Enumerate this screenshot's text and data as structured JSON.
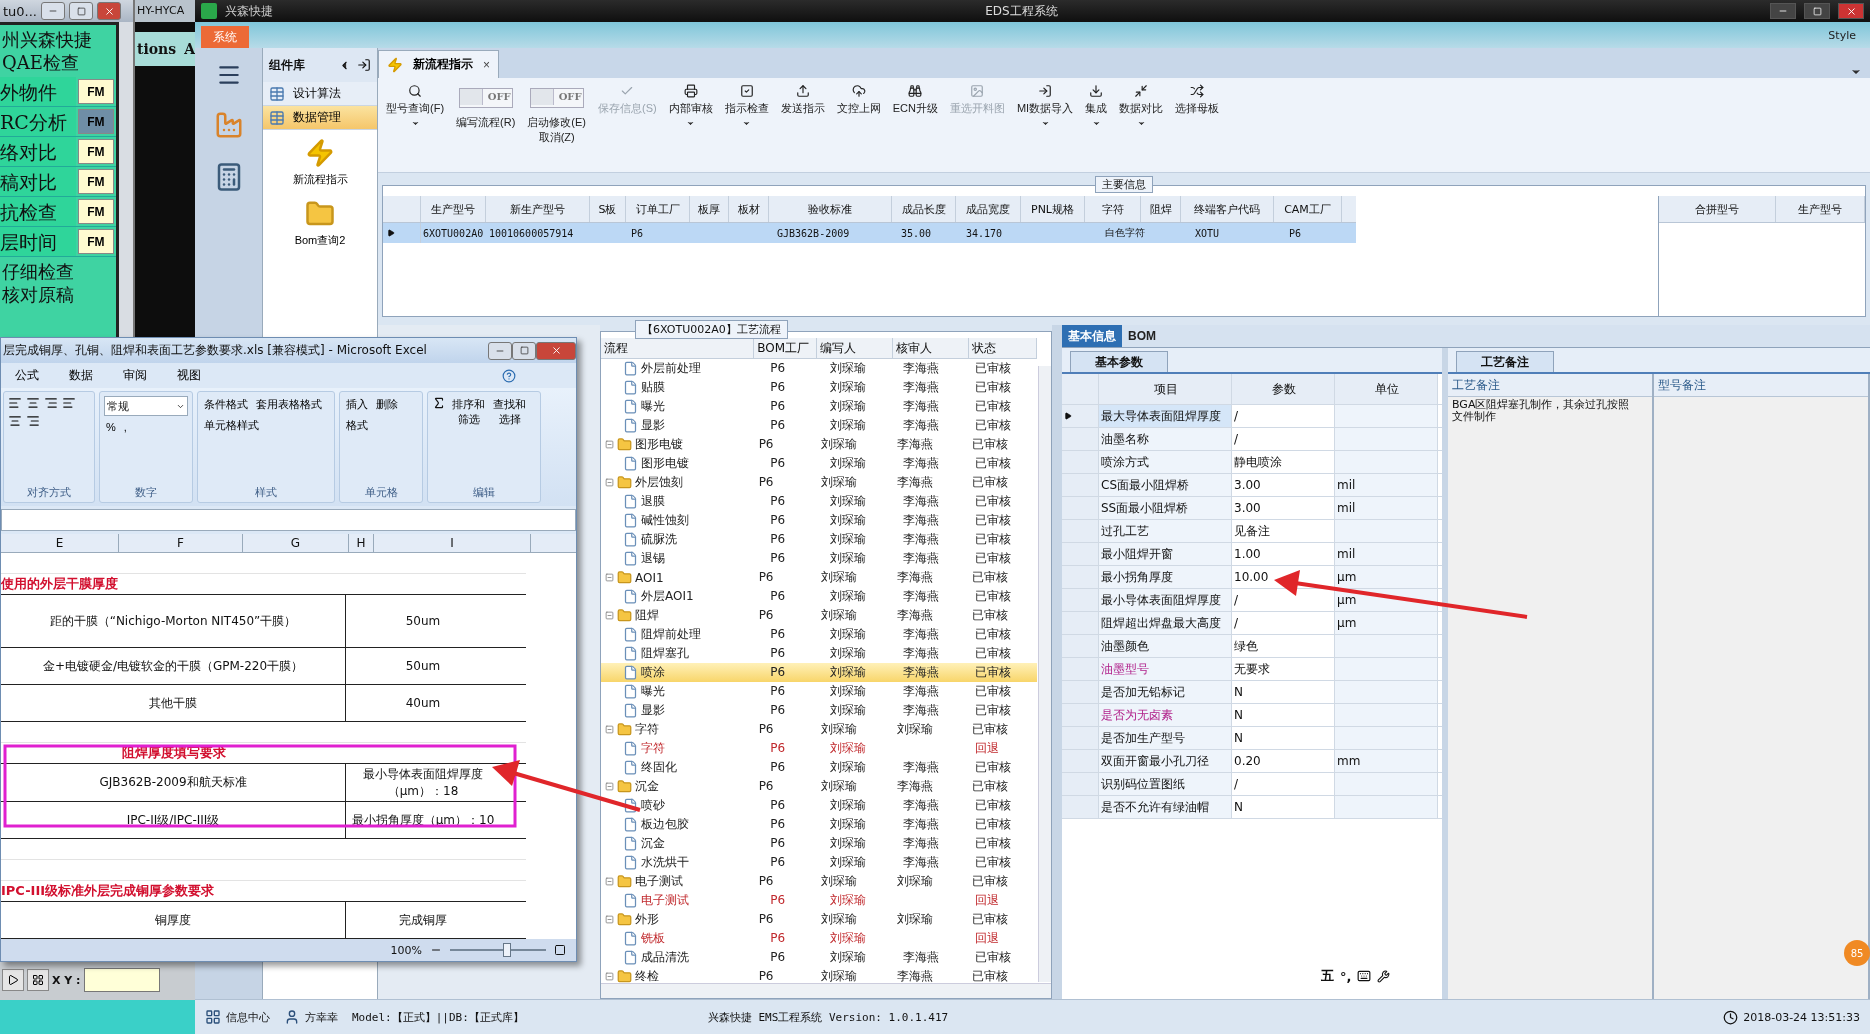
{
  "background_window": {
    "title": "tu0...",
    "items": [
      {
        "lines": [
          "州兴森快捷",
          "QAE检查"
        ]
      },
      {
        "label": "外物件",
        "button": "FM",
        "selected": false
      },
      {
        "label": "RC分析",
        "button": "FM",
        "selected": true
      },
      {
        "label": "络对比",
        "button": "FM",
        "selected": false
      },
      {
        "label": "稿对比",
        "button": "FM",
        "selected": false
      },
      {
        "label": "抗检查",
        "button": "FM",
        "selected": false
      },
      {
        "label": "层时间",
        "button": "FM",
        "selected": false
      },
      {
        "lines": [
          "仔细检查",
          "核对原稿"
        ]
      }
    ],
    "coordinate_label": "X Y :"
  },
  "second_window": {
    "title": "HY-HYCA",
    "menu": [
      "tions",
      "A"
    ]
  },
  "app": {
    "brand": "兴森快捷",
    "title": "EDS工程系统",
    "system_menu": "系统",
    "style_label": "Style"
  },
  "component_library": {
    "title": "组件库",
    "items": [
      {
        "label": "设计算法",
        "selected": false
      },
      {
        "label": "数据管理",
        "selected": true
      }
    ],
    "shortcuts": [
      {
        "label": "新流程指示",
        "kind": "lightning"
      },
      {
        "label": "Bom查询2",
        "kind": "folder"
      }
    ]
  },
  "document_tab": {
    "label": "新流程指示",
    "close": "×"
  },
  "toolbar": [
    {
      "kind": "button",
      "label": "型号查询(F)",
      "dropdown": true,
      "disabled": false
    },
    {
      "kind": "toggle",
      "label": "编写流程(R)",
      "state": "OFF"
    },
    {
      "kind": "toggle",
      "label": "启动修改(E)\n取消(Z)",
      "state": "OFF"
    },
    {
      "kind": "button",
      "label": "保存信息(S)",
      "dropdown": false,
      "disabled": true
    },
    {
      "kind": "button",
      "label": "内部审核",
      "dropdown": true,
      "disabled": false
    },
    {
      "kind": "button",
      "label": "指示检查",
      "dropdown": true,
      "disabled": false
    },
    {
      "kind": "button",
      "label": "发送指示",
      "dropdown": false,
      "disabled": false
    },
    {
      "kind": "button",
      "label": "文控上网",
      "dropdown": false,
      "disabled": false
    },
    {
      "kind": "button",
      "label": "ECN升级",
      "dropdown": false,
      "disabled": false
    },
    {
      "kind": "button",
      "label": "重选开料图",
      "dropdown": false,
      "disabled": true
    },
    {
      "kind": "button",
      "label": "MI数据导入",
      "dropdown": true,
      "disabled": false
    },
    {
      "kind": "button",
      "label": "集成",
      "dropdown": true,
      "disabled": false
    },
    {
      "kind": "button",
      "label": "数据对比",
      "dropdown": true,
      "disabled": false
    },
    {
      "kind": "button",
      "label": "选择母板",
      "dropdown": false,
      "disabled": false
    }
  ],
  "main_info": {
    "title": "主要信息",
    "columns": [
      "生产型号",
      "新生产型号",
      "S板",
      "订单工厂",
      "板厚",
      "板材",
      "验收标准",
      "成品长度",
      "成品宽度",
      "PNL规格",
      "字符",
      "阻焊",
      "终端客户代码",
      "CAM工厂"
    ],
    "rows": [
      {
        "selected": true,
        "cells": [
          "6XOTU002A0",
          "10010600057914",
          "",
          "P6",
          "",
          "",
          "GJB362B-2009",
          "35.00",
          "34.170",
          "",
          "白色字符",
          "",
          "XOTU",
          "P6"
        ]
      }
    ],
    "side_columns": [
      "合拼型号",
      "生产型号"
    ]
  },
  "process": {
    "title": "【6XOTU002A0】工艺流程",
    "columns": [
      "流程",
      "BOM工厂",
      "编写人",
      "核审人",
      "状态"
    ],
    "continued_children": [
      {
        "kind": "leaf",
        "name": "外层前处理",
        "factory": "P6",
        "writer": "刘琛瑜",
        "reviewer": "李海燕",
        "status": "已审核",
        "rejected": false,
        "selected": false
      },
      {
        "kind": "leaf",
        "name": "贴膜",
        "factory": "P6",
        "writer": "刘琛瑜",
        "reviewer": "李海燕",
        "status": "已审核",
        "rejected": false,
        "selected": false
      },
      {
        "kind": "leaf",
        "name": "曝光",
        "factory": "P6",
        "writer": "刘琛瑜",
        "reviewer": "李海燕",
        "status": "已审核",
        "rejected": false,
        "selected": false
      },
      {
        "kind": "leaf",
        "name": "显影",
        "factory": "P6",
        "writer": "刘琛瑜",
        "reviewer": "李海燕",
        "status": "已审核",
        "rejected": false,
        "selected": false
      }
    ],
    "tree": [
      {
        "kind": "folder",
        "name": "图形电镀",
        "factory": "P6",
        "writer": "刘琛瑜",
        "reviewer": "李海燕",
        "status": "已审核",
        "rejected": false,
        "selected": false,
        "children": [
          {
            "kind": "leaf",
            "name": "图形电镀",
            "factory": "P6",
            "writer": "刘琛瑜",
            "reviewer": "李海燕",
            "status": "已审核",
            "rejected": false,
            "selected": false
          }
        ]
      },
      {
        "kind": "folder",
        "name": "外层蚀刻",
        "factory": "P6",
        "writer": "刘琛瑜",
        "reviewer": "李海燕",
        "status": "已审核",
        "rejected": false,
        "selected": false,
        "children": [
          {
            "kind": "leaf",
            "name": "退膜",
            "factory": "P6",
            "writer": "刘琛瑜",
            "reviewer": "李海燕",
            "status": "已审核",
            "rejected": false,
            "selected": false
          },
          {
            "kind": "leaf",
            "name": "碱性蚀刻",
            "factory": "P6",
            "writer": "刘琛瑜",
            "reviewer": "李海燕",
            "status": "已审核",
            "rejected": false,
            "selected": false
          },
          {
            "kind": "leaf",
            "name": "硫脲洗",
            "factory": "P6",
            "writer": "刘琛瑜",
            "reviewer": "李海燕",
            "status": "已审核",
            "rejected": false,
            "selected": false
          },
          {
            "kind": "leaf",
            "name": "退锡",
            "factory": "P6",
            "writer": "刘琛瑜",
            "reviewer": "李海燕",
            "status": "已审核",
            "rejected": false,
            "selected": false
          }
        ]
      },
      {
        "kind": "folder",
        "name": "AOI1",
        "factory": "P6",
        "writer": "刘琛瑜",
        "reviewer": "李海燕",
        "status": "已审核",
        "rejected": false,
        "selected": false,
        "children": [
          {
            "kind": "leaf",
            "name": "外层AOI1",
            "factory": "P6",
            "writer": "刘琛瑜",
            "reviewer": "李海燕",
            "status": "已审核",
            "rejected": false,
            "selected": false
          }
        ]
      },
      {
        "kind": "folder",
        "name": "阻焊",
        "factory": "P6",
        "writer": "刘琛瑜",
        "reviewer": "李海燕",
        "status": "已审核",
        "rejected": false,
        "selected": false,
        "children": [
          {
            "kind": "leaf",
            "name": "阻焊前处理",
            "factory": "P6",
            "writer": "刘琛瑜",
            "reviewer": "李海燕",
            "status": "已审核",
            "rejected": false,
            "selected": false
          },
          {
            "kind": "leaf",
            "name": "阻焊塞孔",
            "factory": "P6",
            "writer": "刘琛瑜",
            "reviewer": "李海燕",
            "status": "已审核",
            "rejected": false,
            "selected": false
          },
          {
            "kind": "leaf",
            "name": "喷涂",
            "factory": "P6",
            "writer": "刘琛瑜",
            "reviewer": "李海燕",
            "status": "已审核",
            "rejected": false,
            "selected": true
          },
          {
            "kind": "leaf",
            "name": "曝光",
            "factory": "P6",
            "writer": "刘琛瑜",
            "reviewer": "李海燕",
            "status": "已审核",
            "rejected": false,
            "selected": false
          },
          {
            "kind": "leaf",
            "name": "显影",
            "factory": "P6",
            "writer": "刘琛瑜",
            "reviewer": "李海燕",
            "status": "已审核",
            "rejected": false,
            "selected": false
          }
        ]
      },
      {
        "kind": "folder",
        "name": "字符",
        "factory": "P6",
        "writer": "刘琛瑜",
        "reviewer": "刘琛瑜",
        "status": "已审核",
        "rejected": false,
        "selected": false,
        "children": [
          {
            "kind": "leaf",
            "name": "字符",
            "factory": "P6",
            "writer": "刘琛瑜",
            "status": "回退",
            "rejected": true,
            "selected": false
          },
          {
            "kind": "leaf",
            "name": "终固化",
            "factory": "P6",
            "writer": "刘琛瑜",
            "reviewer": "李海燕",
            "status": "已审核",
            "rejected": false,
            "selected": false
          }
        ]
      },
      {
        "kind": "folder",
        "name": "沉金",
        "factory": "P6",
        "writer": "刘琛瑜",
        "reviewer": "李海燕",
        "status": "已审核",
        "rejected": false,
        "selected": false,
        "children": [
          {
            "kind": "leaf",
            "name": "喷砂",
            "factory": "P6",
            "writer": "刘琛瑜",
            "reviewer": "李海燕",
            "status": "已审核",
            "rejected": false,
            "selected": false
          },
          {
            "kind": "leaf",
            "name": "板边包胶",
            "factory": "P6",
            "writer": "刘琛瑜",
            "reviewer": "李海燕",
            "status": "已审核",
            "rejected": false,
            "selected": false
          },
          {
            "kind": "leaf",
            "name": "沉金",
            "factory": "P6",
            "writer": "刘琛瑜",
            "reviewer": "李海燕",
            "status": "已审核",
            "rejected": false,
            "selected": false
          },
          {
            "kind": "leaf",
            "name": "水洗烘干",
            "factory": "P6",
            "writer": "刘琛瑜",
            "reviewer": "李海燕",
            "status": "已审核",
            "rejected": false,
            "selected": false
          }
        ]
      },
      {
        "kind": "folder",
        "name": "电子测试",
        "factory": "P6",
        "writer": "刘琛瑜",
        "reviewer": "刘琛瑜",
        "status": "已审核",
        "rejected": false,
        "selected": false,
        "children": [
          {
            "kind": "leaf",
            "name": "电子测试",
            "factory": "P6",
            "writer": "刘琛瑜",
            "status": "回退",
            "rejected": true,
            "selected": false
          }
        ]
      },
      {
        "kind": "folder",
        "name": "外形",
        "factory": "P6",
        "writer": "刘琛瑜",
        "reviewer": "刘琛瑜",
        "status": "已审核",
        "rejected": false,
        "selected": false,
        "children": [
          {
            "kind": "leaf",
            "name": "铣板",
            "factory": "P6",
            "writer": "刘琛瑜",
            "status": "回退",
            "rejected": true,
            "selected": false
          },
          {
            "kind": "leaf",
            "name": "成品清洗",
            "factory": "P6",
            "writer": "刘琛瑜",
            "reviewer": "李海燕",
            "status": "已审核",
            "rejected": false,
            "selected": false
          }
        ]
      },
      {
        "kind": "folder",
        "name": "终检",
        "factory": "P6",
        "writer": "刘琛瑜",
        "reviewer": "李海燕",
        "status": "已审核",
        "rejected": false,
        "selected": false
      }
    ]
  },
  "detail": {
    "tabs": [
      {
        "label": "基本信息",
        "selected": true
      },
      {
        "label": "BOM",
        "selected": false
      }
    ],
    "params_tab": "基本参数",
    "columns": [
      "项目",
      "参数",
      "单位"
    ],
    "rows": [
      {
        "item": "最大导体表面阻焊厚度",
        "value": "/",
        "current": true,
        "flagged": false
      },
      {
        "item": "油墨名称",
        "value": "/",
        "current": false,
        "flagged": false
      },
      {
        "item": "喷涂方式",
        "value": "静电喷涂",
        "current": false,
        "flagged": false
      },
      {
        "item": "CS面最小阻焊桥",
        "value": "3.00",
        "unit": "mil",
        "current": false,
        "flagged": false
      },
      {
        "item": "SS面最小阻焊桥",
        "value": "3.00",
        "unit": "mil",
        "current": false,
        "flagged": false
      },
      {
        "item": "过孔工艺",
        "value": "见备注",
        "current": false,
        "flagged": false
      },
      {
        "item": "最小阻焊开窗",
        "value": "1.00",
        "unit": "mil",
        "current": false,
        "flagged": false
      },
      {
        "item": "最小拐角厚度",
        "value": "10.00",
        "unit": "μm",
        "current": false,
        "flagged": false
      },
      {
        "item": "最小导体表面阻焊厚度",
        "value": "/",
        "unit": "μm",
        "current": false,
        "flagged": false
      },
      {
        "item": "阻焊超出焊盘最大高度",
        "value": "/",
        "unit": "μm",
        "current": false,
        "flagged": false
      },
      {
        "item": "油墨颜色",
        "value": "绿色",
        "current": false,
        "flagged": false
      },
      {
        "item": "油墨型号",
        "value": "无要求",
        "current": false,
        "flagged": true
      },
      {
        "item": "是否加无铅标记",
        "value": "N",
        "current": false,
        "flagged": false
      },
      {
        "item": "是否为无卤素",
        "value": "N",
        "current": false,
        "flagged": true
      },
      {
        "item": "是否加生产型号",
        "value": "N",
        "current": false,
        "flagged": false
      },
      {
        "item": "双面开窗最小孔刀径",
        "value": "0.20",
        "unit": "mm",
        "current": false,
        "flagged": false
      },
      {
        "item": "识别码位置图纸",
        "value": "/",
        "current": false,
        "flagged": false
      },
      {
        "item": "是否不允许有绿油帽",
        "value": "N",
        "current": false,
        "flagged": false
      }
    ],
    "remarks_tab": "工艺备注",
    "remarks_columns": [
      "工艺备注",
      "型号备注"
    ],
    "process_remark": "BGA区阻焊塞孔制作，其余过孔按照文件制作"
  },
  "excel": {
    "title": "层完成铜厚、孔铜、阻焊和表面工艺参数要求.xls [兼容模式] - Microsoft Excel",
    "ribbon_tabs": [
      "公式",
      "数据",
      "审阅",
      "视图"
    ],
    "groups": [
      {
        "label": "对齐方式"
      },
      {
        "label": "数字",
        "format": "常规",
        "symbols": [
          "%",
          ","
        ]
      },
      {
        "label": "样式",
        "commands": [
          {
            "lines": [
              "条件格式"
            ]
          },
          {
            "lines": [
              "套用表格格式"
            ]
          },
          {
            "lines": [
              "单元格样式"
            ]
          }
        ]
      },
      {
        "label": "单元格",
        "commands": [
          {
            "lines": [
              "插入"
            ]
          },
          {
            "lines": [
              "删除"
            ]
          },
          {
            "lines": [
              "格式"
            ]
          }
        ]
      },
      {
        "label": "编辑",
        "commands": [
          {
            "lines": [
              "排序和",
              "筛选"
            ]
          },
          {
            "lines": [
              "查找和",
              "选择"
            ]
          }
        ]
      }
    ],
    "column_headers": [
      "E",
      "F",
      "G",
      "H",
      "I"
    ],
    "rows": [
      {
        "kind": "blank"
      },
      {
        "kind": "heading",
        "text": "使用的外层干膜厚度"
      },
      {
        "kind": "pair",
        "left": "距的干膜（“Nichigo-Morton NIT450”干膜）",
        "right": "50um"
      },
      {
        "kind": "pair",
        "left": "金+电镀硬金/电镀软金的干膜（GPM-220干膜）",
        "right": "50um"
      },
      {
        "kind": "pair",
        "left": "其他干膜",
        "right": "40um"
      },
      {
        "kind": "blank"
      },
      {
        "kind": "centered_heading",
        "text": "阻焊厚度填写要求"
      },
      {
        "kind": "pair",
        "left": "GJB362B-2009和航天标准",
        "right": "最小导体表面阻焊厚度（μm）：18"
      },
      {
        "kind": "pair",
        "left": "IPC-II级/IPC-III级",
        "right": "最小拐角厚度（μm）：10"
      },
      {
        "kind": "blank"
      },
      {
        "kind": "blank"
      },
      {
        "kind": "heading",
        "text": "IPC-III级标准外层完成铜厚参数要求"
      },
      {
        "kind": "pair",
        "left": "铜厚度",
        "right": "完成铜厚"
      }
    ],
    "zoom": "100%",
    "zoom_slider": {
      "level": 0.6
    }
  },
  "status_bar": {
    "info_center": "信息中心",
    "user": "方幸幸",
    "model": "Model:【正式】||DB:【正式库】",
    "product": "兴森快捷 EMS工程系统 Version: 1.0.1.417",
    "datetime": "2018-03-24 13:51:33"
  },
  "ime_bar": {
    "mode": "五",
    "punct": "°,"
  },
  "notification_badge": "85"
}
